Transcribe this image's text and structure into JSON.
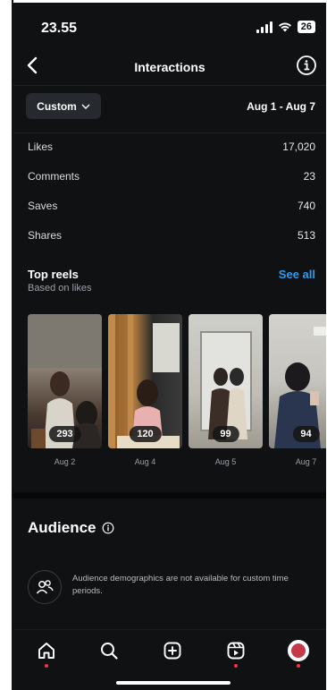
{
  "status": {
    "time": "23.55",
    "battery": "26"
  },
  "header": {
    "title": "Interactions"
  },
  "filter": {
    "label": "Custom",
    "range": "Aug 1 - Aug 7"
  },
  "metrics": [
    {
      "label": "Likes",
      "value": "17,020"
    },
    {
      "label": "Comments",
      "value": "23"
    },
    {
      "label": "Saves",
      "value": "740"
    },
    {
      "label": "Shares",
      "value": "513"
    }
  ],
  "top_reels": {
    "title": "Top reels",
    "subtitle": "Based on likes",
    "see_all": "See all",
    "items": [
      {
        "count": "293",
        "date": "Aug 2"
      },
      {
        "count": "120",
        "date": "Aug 4"
      },
      {
        "count": "99",
        "date": "Aug 5"
      },
      {
        "count": "94",
        "date": "Aug 7"
      }
    ]
  },
  "audience": {
    "title": "Audience",
    "message": "Audience demographics are not available for custom time periods."
  },
  "colors": {
    "background": "#0f1113",
    "accent": "#2d9bf0",
    "notification": "#ff3040"
  },
  "nav": [
    "home-icon",
    "search-icon",
    "create-icon",
    "reels-icon",
    "profile-avatar"
  ]
}
